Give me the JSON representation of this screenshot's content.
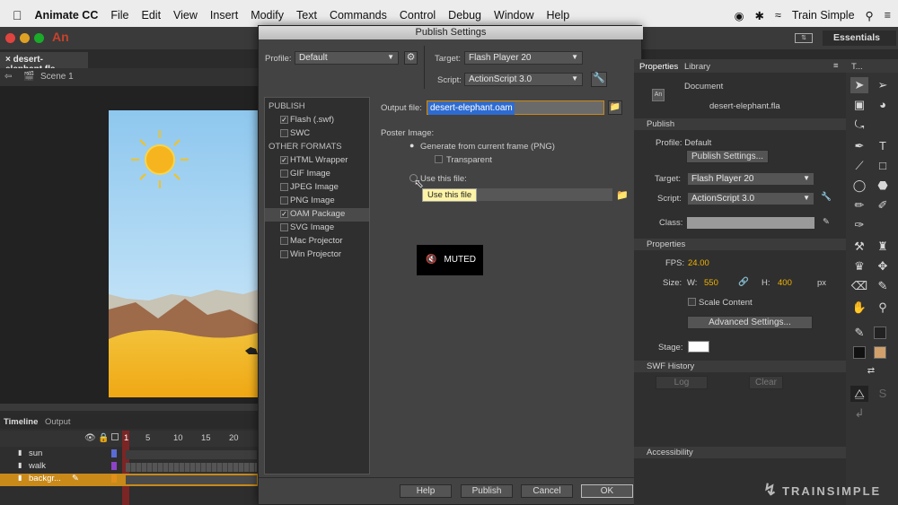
{
  "menubar": {
    "apple": "",
    "app": "Animate CC",
    "items": [
      "File",
      "Edit",
      "View",
      "Insert",
      "Modify",
      "Text",
      "Commands",
      "Control",
      "Debug",
      "Window",
      "Help"
    ],
    "user": "Train Simple"
  },
  "appbar": {
    "logo": "An",
    "workspace": "Essentials"
  },
  "document": {
    "tab": "desert-elephant.fla",
    "scene": "Scene 1"
  },
  "timeline": {
    "tab": "Timeline",
    "tab2": "Output",
    "frames": [
      "1",
      "5",
      "10",
      "15",
      "20"
    ],
    "layers": [
      "sun",
      "walk",
      "backgr..."
    ]
  },
  "dialog": {
    "title": "Publish Settings",
    "profile_label": "Profile:",
    "profile": "Default",
    "target_label": "Target:",
    "target": "Flash Player 20",
    "script_label": "Script:",
    "script": "ActionScript 3.0",
    "publish_head": "PUBLISH",
    "other_head": "OTHER FORMATS",
    "publish_items": [
      {
        "label": "Flash (.swf)",
        "checked": true
      },
      {
        "label": "SWC",
        "checked": false
      }
    ],
    "other_items": [
      {
        "label": "HTML Wrapper",
        "checked": true
      },
      {
        "label": "GIF Image",
        "checked": false
      },
      {
        "label": "JPEG Image",
        "checked": false
      },
      {
        "label": "PNG Image",
        "checked": false
      },
      {
        "label": "OAM Package",
        "checked": true
      },
      {
        "label": "SVG Image",
        "checked": false
      },
      {
        "label": "Mac Projector",
        "checked": false
      },
      {
        "label": "Win Projector",
        "checked": false
      }
    ],
    "output_label": "Output file:",
    "output": "desert-elephant.oam",
    "poster_label": "Poster Image:",
    "gen_label": "Generate from current frame (PNG)",
    "transparent_label": "Transparent",
    "use_label": "Use this file:",
    "tooltip": "Use this file",
    "muted": "MUTED",
    "buttons": {
      "help": "Help",
      "publish": "Publish",
      "cancel": "Cancel",
      "ok": "OK"
    }
  },
  "props": {
    "tab1": "Properties",
    "tab2": "Library",
    "doc_label": "Document",
    "doc_name": "desert-elephant.fla",
    "publish_head": "Publish",
    "profile": "Profile: Default",
    "publish_settings_btn": "Publish Settings...",
    "target_label": "Target:",
    "target": "Flash Player 20",
    "script_label": "Script:",
    "script": "ActionScript 3.0",
    "class_label": "Class:",
    "properties_head": "Properties",
    "fps_label": "FPS:",
    "fps": "24.00",
    "size_label": "Size:",
    "w_label": "W:",
    "w": "550",
    "h_label": "H:",
    "h": "400",
    "px": "px",
    "scale_label": "Scale Content",
    "advanced_btn": "Advanced Settings...",
    "stage_label": "Stage:",
    "swf_head": "SWF History",
    "log": "Log",
    "clear": "Clear",
    "access_head": "Accessibility"
  },
  "tools": {
    "tab": "T..."
  },
  "watermark": "TRAINSIMPLE",
  "colors": {
    "accent": "#f2b300",
    "selected_row": "#c98a1a"
  }
}
